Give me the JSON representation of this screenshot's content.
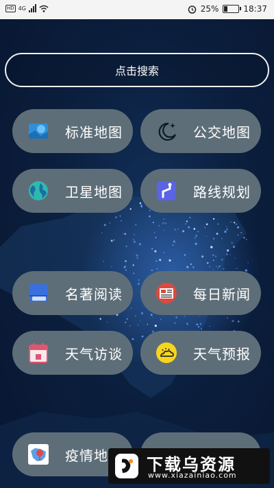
{
  "status_bar": {
    "signal_label": "4G",
    "battery": "25%",
    "battery_level": 0.25,
    "time": "18:37"
  },
  "search": {
    "label": "点击搜索"
  },
  "menu": [
    {
      "label": "标准地图",
      "icon": "standard-map-icon"
    },
    {
      "label": "公交地图",
      "icon": "moon-stars-icon"
    },
    {
      "label": "卫星地图",
      "icon": "globe-icon"
    },
    {
      "label": "路线规划",
      "icon": "route-icon"
    },
    {
      "label": "名著阅读",
      "icon": "book-icon"
    },
    {
      "label": "每日新闻",
      "icon": "newspaper-icon"
    },
    {
      "label": "天气访谈",
      "icon": "calendar-icon"
    },
    {
      "label": "天气预报",
      "icon": "sun-cloud-icon"
    },
    {
      "label": "疫情地图",
      "icon": "epidemic-map-icon"
    }
  ],
  "watermark": {
    "title": "下载乌资源",
    "url": "www.xiazainiao.com"
  }
}
